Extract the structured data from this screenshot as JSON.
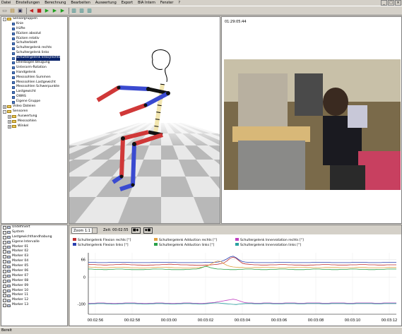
{
  "menu": {
    "items": [
      "Datei",
      "Einstellungen",
      "Berechnung",
      "Bearbeiten",
      "Auswertung",
      "Export",
      "BIA Intern",
      "Fenster",
      "?"
    ]
  },
  "window_controls": [
    "_",
    "□",
    "×"
  ],
  "toolbar": {
    "icons": [
      "new-icon",
      "open-icon",
      "save-icon",
      "rewind-icon",
      "stop-icon",
      "play-icon",
      "step-icon",
      "forward-icon",
      "channel-icon",
      "channel-icon",
      "channel-icon"
    ]
  },
  "tree": {
    "items": [
      {
        "label": "Sensorgruppen",
        "level": 0,
        "expand": "-",
        "icon": "folder"
      },
      {
        "label": "Knie",
        "level": 1,
        "icon": "leaf"
      },
      {
        "label": "Hüfte",
        "level": 1,
        "icon": "leaf"
      },
      {
        "label": "Rücken absolut",
        "level": 1,
        "icon": "leaf"
      },
      {
        "label": "Rücken relativ",
        "level": 1,
        "icon": "leaf"
      },
      {
        "label": "Schulterblatt",
        "level": 1,
        "icon": "leaf"
      },
      {
        "label": "Schultergelenk rechts",
        "level": 1,
        "icon": "leaf"
      },
      {
        "label": "Schultergelenk links",
        "level": 1,
        "icon": "leaf"
      },
      {
        "label": "Schultergelenk links|rechts",
        "level": 1,
        "icon": "leaf",
        "selected": true
      },
      {
        "label": "Ellenbogen Beugung",
        "level": 1,
        "icon": "leaf"
      },
      {
        "label": "Unterarm-Rotation",
        "level": 1,
        "icon": "leaf"
      },
      {
        "label": "Handgelenk",
        "level": 1,
        "icon": "leaf"
      },
      {
        "label": "Messsohlen Summen",
        "level": 1,
        "icon": "leaf"
      },
      {
        "label": "Messsohlen Lastgewicht",
        "level": 1,
        "icon": "leaf"
      },
      {
        "label": "Messsohlen Schwerpunkte",
        "level": 1,
        "icon": "leaf"
      },
      {
        "label": "Lastgewicht",
        "level": 1,
        "icon": "leaf"
      },
      {
        "label": "OWAS",
        "level": 1,
        "icon": "leaf"
      },
      {
        "label": "Eigene Gruppe",
        "level": 1,
        "icon": "leaf"
      },
      {
        "label": "Video Dateien",
        "level": 0,
        "expand": "+",
        "icon": "folder"
      },
      {
        "label": "Sensoren",
        "level": 0,
        "expand": "-",
        "icon": "folder"
      },
      {
        "label": "Auswertung",
        "level": 1,
        "expand": "+",
        "icon": "folder"
      },
      {
        "label": "Messsohlen",
        "level": 1,
        "expand": "+",
        "icon": "folder"
      },
      {
        "label": "Winkel",
        "level": 1,
        "expand": "+",
        "icon": "folder"
      }
    ]
  },
  "video": {
    "timecode": "01:29:05:44"
  },
  "chart_controls": {
    "zoom": "Zoom 1:1",
    "zeit_label": "Zeit",
    "zeit_value": "00:02:55"
  },
  "markers": {
    "items": [
      "Undefiniert",
      "System",
      "Lastgewichthandhabung",
      "Eigene Intervalle",
      "Marker 01",
      "Marker 02",
      "Marker 03",
      "Marker 04",
      "Marker 05",
      "Marker 06",
      "Marker 07",
      "Marker 08",
      "Marker 09",
      "Marker 10",
      "Marker 11",
      "Marker 12",
      "Marker 13"
    ]
  },
  "status": {
    "text": "Bereit"
  },
  "colors": {
    "series1": "#c03030",
    "series2": "#2a3fb0",
    "series3": "#e0a040",
    "series4": "#28a048",
    "series5": "#c040c0",
    "series6": "#2aa0a0"
  },
  "chart_data": {
    "type": "line",
    "ylim": [
      -130,
      80
    ],
    "yticks": [
      66,
      0,
      -100
    ],
    "x_ticks": [
      "00:02:56",
      "00:02:58",
      "00:03:00",
      "00:03:02",
      "00:03:04",
      "00:03:06",
      "00:03:08",
      "00:03:10",
      "00:03:12"
    ],
    "x": [
      0,
      1,
      2,
      3,
      4,
      5,
      6,
      7,
      8,
      9,
      10,
      11,
      12,
      13,
      14,
      15,
      16,
      17,
      18,
      19,
      20,
      21,
      22,
      23,
      24,
      25,
      26,
      27,
      28,
      29,
      30,
      31,
      32,
      33,
      34,
      35,
      36,
      37,
      38,
      39,
      40,
      41,
      42,
      43,
      44,
      45,
      46,
      47,
      48,
      49,
      50,
      51,
      52,
      53,
      54,
      55,
      56,
      57,
      58,
      59,
      60,
      61,
      62,
      63,
      64,
      65,
      66,
      67,
      68,
      69,
      70,
      71,
      72,
      73,
      74,
      75,
      76,
      77,
      78,
      79,
      80,
      81,
      82,
      83,
      84,
      85,
      86,
      87,
      88,
      89,
      90,
      91,
      92,
      93,
      94,
      95,
      96,
      97,
      98,
      99,
      100
    ],
    "series": [
      {
        "name": "Schultergelenk Flexion rechts [°]",
        "color_key": "series1",
        "values": [
          48,
          47,
          47,
          46,
          46,
          45,
          45,
          46,
          46,
          47,
          47,
          48,
          48,
          47,
          46,
          46,
          45,
          45,
          44,
          44,
          45,
          45,
          46,
          46,
          47,
          47,
          48,
          48,
          47,
          47,
          46,
          46,
          46,
          45,
          45,
          44,
          44,
          44,
          45,
          45,
          46,
          47,
          48,
          50,
          53,
          60,
          70,
          74,
          70,
          60,
          52,
          49,
          48,
          47,
          46,
          46,
          45,
          45,
          45,
          46,
          46,
          46,
          47,
          47,
          47,
          46,
          46,
          45,
          45,
          45,
          44,
          44,
          45,
          45,
          46,
          46,
          47,
          47,
          47,
          46,
          46,
          45,
          45,
          45,
          45,
          46,
          46,
          46,
          47,
          47,
          47,
          46,
          46,
          46,
          45,
          45,
          45,
          46,
          46,
          46,
          46
        ]
      },
      {
        "name": "Schultergelenk Flexion links [°]",
        "color_key": "series2",
        "values": [
          55,
          55,
          55,
          54,
          54,
          54,
          54,
          55,
          55,
          55,
          55,
          55,
          55,
          55,
          54,
          54,
          54,
          54,
          54,
          54,
          54,
          55,
          55,
          55,
          55,
          55,
          55,
          55,
          55,
          54,
          54,
          54,
          54,
          54,
          54,
          54,
          54,
          54,
          55,
          55,
          55,
          55,
          56,
          58,
          62,
          68,
          75,
          78,
          72,
          64,
          58,
          56,
          55,
          55,
          54,
          54,
          54,
          54,
          54,
          54,
          54,
          55,
          55,
          55,
          55,
          55,
          54,
          54,
          54,
          54,
          54,
          54,
          54,
          55,
          55,
          55,
          55,
          55,
          55,
          54,
          54,
          54,
          54,
          54,
          54,
          54,
          55,
          55,
          55,
          55,
          55,
          54,
          54,
          54,
          54,
          54,
          55,
          55,
          55,
          55,
          55
        ]
      },
      {
        "name": "Schultergelenk Adduction rechts [°]",
        "color_key": "series3",
        "values": [
          38,
          37,
          37,
          36,
          36,
          35,
          35,
          36,
          36,
          37,
          37,
          37,
          36,
          36,
          35,
          35,
          35,
          34,
          34,
          35,
          35,
          36,
          36,
          37,
          37,
          37,
          36,
          36,
          35,
          35,
          35,
          34,
          34,
          34,
          35,
          35,
          36,
          37,
          40,
          44,
          50,
          56,
          60,
          58,
          50,
          44,
          40,
          38,
          37,
          36,
          36,
          35,
          35,
          35,
          36,
          36,
          36,
          37,
          37,
          36,
          36,
          35,
          35,
          35,
          35,
          36,
          36,
          36,
          37,
          37,
          37,
          36,
          36,
          35,
          35,
          35,
          35,
          36,
          36,
          36,
          36,
          36,
          35,
          35,
          35,
          35,
          35,
          36,
          36,
          36,
          36,
          35,
          35,
          35,
          35,
          35,
          35,
          36,
          36,
          36,
          36
        ]
      },
      {
        "name": "Schultergelenk Adduction links [°]",
        "color_key": "series4",
        "values": [
          30,
          30,
          29,
          29,
          29,
          28,
          28,
          29,
          29,
          30,
          30,
          30,
          29,
          29,
          28,
          28,
          28,
          28,
          28,
          29,
          29,
          30,
          30,
          30,
          30,
          29,
          29,
          28,
          28,
          28,
          28,
          28,
          29,
          29,
          30,
          30,
          32,
          36,
          40,
          38,
          34,
          32,
          30,
          30,
          29,
          29,
          28,
          28,
          28,
          29,
          29,
          30,
          30,
          30,
          29,
          29,
          28,
          28,
          28,
          29,
          29,
          29,
          30,
          30,
          30,
          29,
          29,
          28,
          28,
          28,
          28,
          29,
          29,
          30,
          30,
          30,
          29,
          29,
          29,
          28,
          28,
          28,
          29,
          29,
          29,
          30,
          30,
          30,
          29,
          29,
          29,
          28,
          28,
          28,
          29,
          29,
          29,
          30,
          30,
          30,
          30
        ]
      },
      {
        "name": "Schultergelenk Innenrotation rechts [°]",
        "color_key": "series5",
        "values": [
          -98,
          -97,
          -97,
          -96,
          -96,
          -96,
          -97,
          -97,
          -98,
          -98,
          -97,
          -97,
          -96,
          -96,
          -96,
          -96,
          -97,
          -97,
          -98,
          -98,
          -97,
          -97,
          -96,
          -96,
          -96,
          -97,
          -97,
          -98,
          -98,
          -97,
          -97,
          -96,
          -96,
          -96,
          -97,
          -97,
          -98,
          -98,
          -97,
          -96,
          -95,
          -94,
          -92,
          -90,
          -88,
          -86,
          -84,
          -82,
          -84,
          -88,
          -92,
          -95,
          -96,
          -96,
          -97,
          -97,
          -97,
          -96,
          -96,
          -96,
          -97,
          -97,
          -97,
          -97,
          -96,
          -96,
          -96,
          -96,
          -97,
          -97,
          -97,
          -96,
          -96,
          -96,
          -96,
          -96,
          -97,
          -97,
          -97,
          -96,
          -96,
          -96,
          -96,
          -96,
          -97,
          -97,
          -97,
          -96,
          -96,
          -96,
          -96,
          -96,
          -96,
          -97,
          -97,
          -97,
          -96,
          -96,
          -96,
          -96,
          -96
        ]
      },
      {
        "name": "Schultergelenk Innenrotation links [°]",
        "color_key": "series6",
        "values": [
          -100,
          -99,
          -99,
          -98,
          -98,
          -98,
          -99,
          -99,
          -100,
          -100,
          -99,
          -99,
          -98,
          -98,
          -98,
          -98,
          -99,
          -99,
          -100,
          -100,
          -99,
          -99,
          -98,
          -98,
          -98,
          -99,
          -99,
          -100,
          -100,
          -99,
          -99,
          -98,
          -98,
          -98,
          -99,
          -99,
          -100,
          -100,
          -99,
          -98,
          -97,
          -96,
          -96,
          -97,
          -98,
          -99,
          -100,
          -101,
          -102,
          -100,
          -99,
          -98,
          -98,
          -98,
          -99,
          -99,
          -99,
          -98,
          -98,
          -98,
          -99,
          -99,
          -99,
          -99,
          -98,
          -98,
          -98,
          -98,
          -99,
          -99,
          -99,
          -98,
          -98,
          -98,
          -98,
          -98,
          -99,
          -99,
          -99,
          -98,
          -98,
          -98,
          -98,
          -98,
          -99,
          -99,
          -99,
          -98,
          -98,
          -98,
          -98,
          -98,
          -98,
          -99,
          -99,
          -99,
          -98,
          -98,
          -98,
          -98,
          -98
        ]
      }
    ]
  }
}
